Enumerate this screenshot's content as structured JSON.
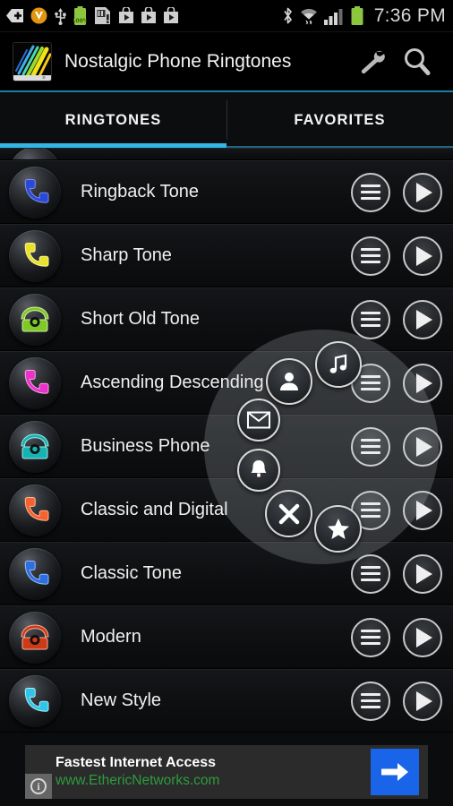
{
  "statusbar": {
    "clock": "7:36 PM",
    "battery_percent": "100%",
    "icons_left": [
      {
        "name": "back-arrow-plus-icon",
        "glyph": "add"
      },
      {
        "name": "vault-app-icon",
        "glyph": "V"
      },
      {
        "name": "usb-icon",
        "glyph": "usb"
      },
      {
        "name": "battery-charge-icon",
        "glyph": "battery"
      },
      {
        "name": "sd-card-alert-icon",
        "glyph": "sd"
      },
      {
        "name": "play-store-download-icon-1",
        "glyph": "bag"
      },
      {
        "name": "play-store-download-icon-2",
        "glyph": "bag"
      },
      {
        "name": "play-store-download-icon-3",
        "glyph": "bag"
      }
    ],
    "icons_right": [
      {
        "name": "bluetooth-icon",
        "glyph": "bt"
      },
      {
        "name": "wifi-icon",
        "glyph": "wifi"
      },
      {
        "name": "cellular-signal-icon",
        "glyph": "signal"
      },
      {
        "name": "battery-status-icon",
        "glyph": "battery"
      }
    ]
  },
  "actionbar": {
    "title": "Nostalgic Phone Ringtones",
    "app_icon_name": "app-logo-icon",
    "settings_label": "Settings",
    "search_label": "Search"
  },
  "tabs": [
    {
      "label": "RINGTONES",
      "active": true
    },
    {
      "label": "FAVORITES",
      "active": false
    }
  ],
  "list": [
    {
      "title": "Ringback Tone",
      "icon": "handset",
      "color": "#2a49d8"
    },
    {
      "title": "Sharp Tone",
      "icon": "handset",
      "color": "#e8e32a"
    },
    {
      "title": "Short Old Tone",
      "icon": "deskphone",
      "color": "#7fc828"
    },
    {
      "title": "Ascending Descending Tone",
      "icon": "handset",
      "color": "#e832c8"
    },
    {
      "title": "Business Phone",
      "icon": "deskphone",
      "color": "#16b3b3"
    },
    {
      "title": "Classic and Digital",
      "icon": "handset",
      "color": "#f4622e"
    },
    {
      "title": "Classic Tone",
      "icon": "handset",
      "color": "#2d6fe0"
    },
    {
      "title": "Modern",
      "icon": "deskphone",
      "color": "#cf3a16"
    },
    {
      "title": "New Style",
      "icon": "handset",
      "color": "#2ec5e8"
    }
  ],
  "row_actions": {
    "menu_label": "Options",
    "play_label": "Play"
  },
  "radial_menu": {
    "items": [
      {
        "name": "set-as-ringtone-icon",
        "label": "Set as ringtone",
        "glyph": "music-note"
      },
      {
        "name": "set-as-contact-ringtone-icon",
        "label": "Set for contact",
        "glyph": "person"
      },
      {
        "name": "share-mail-icon",
        "label": "Send by mail",
        "glyph": "envelope"
      },
      {
        "name": "set-as-notification-icon",
        "label": "Set as notification",
        "glyph": "bell"
      },
      {
        "name": "close-menu-icon",
        "label": "Close",
        "glyph": "cross"
      },
      {
        "name": "add-to-favorites-icon",
        "label": "Add to favorites",
        "glyph": "star"
      }
    ]
  },
  "ad": {
    "headline": "Fastest Internet Access",
    "url": "www.EthericNetworks.com",
    "cta_label": "Go",
    "info_label": "i"
  },
  "colors": {
    "accent_blue": "#33b5e5",
    "ad_green": "#2e9b3e",
    "ad_blue": "#1964e8",
    "battery_green": "#8cc63f"
  }
}
